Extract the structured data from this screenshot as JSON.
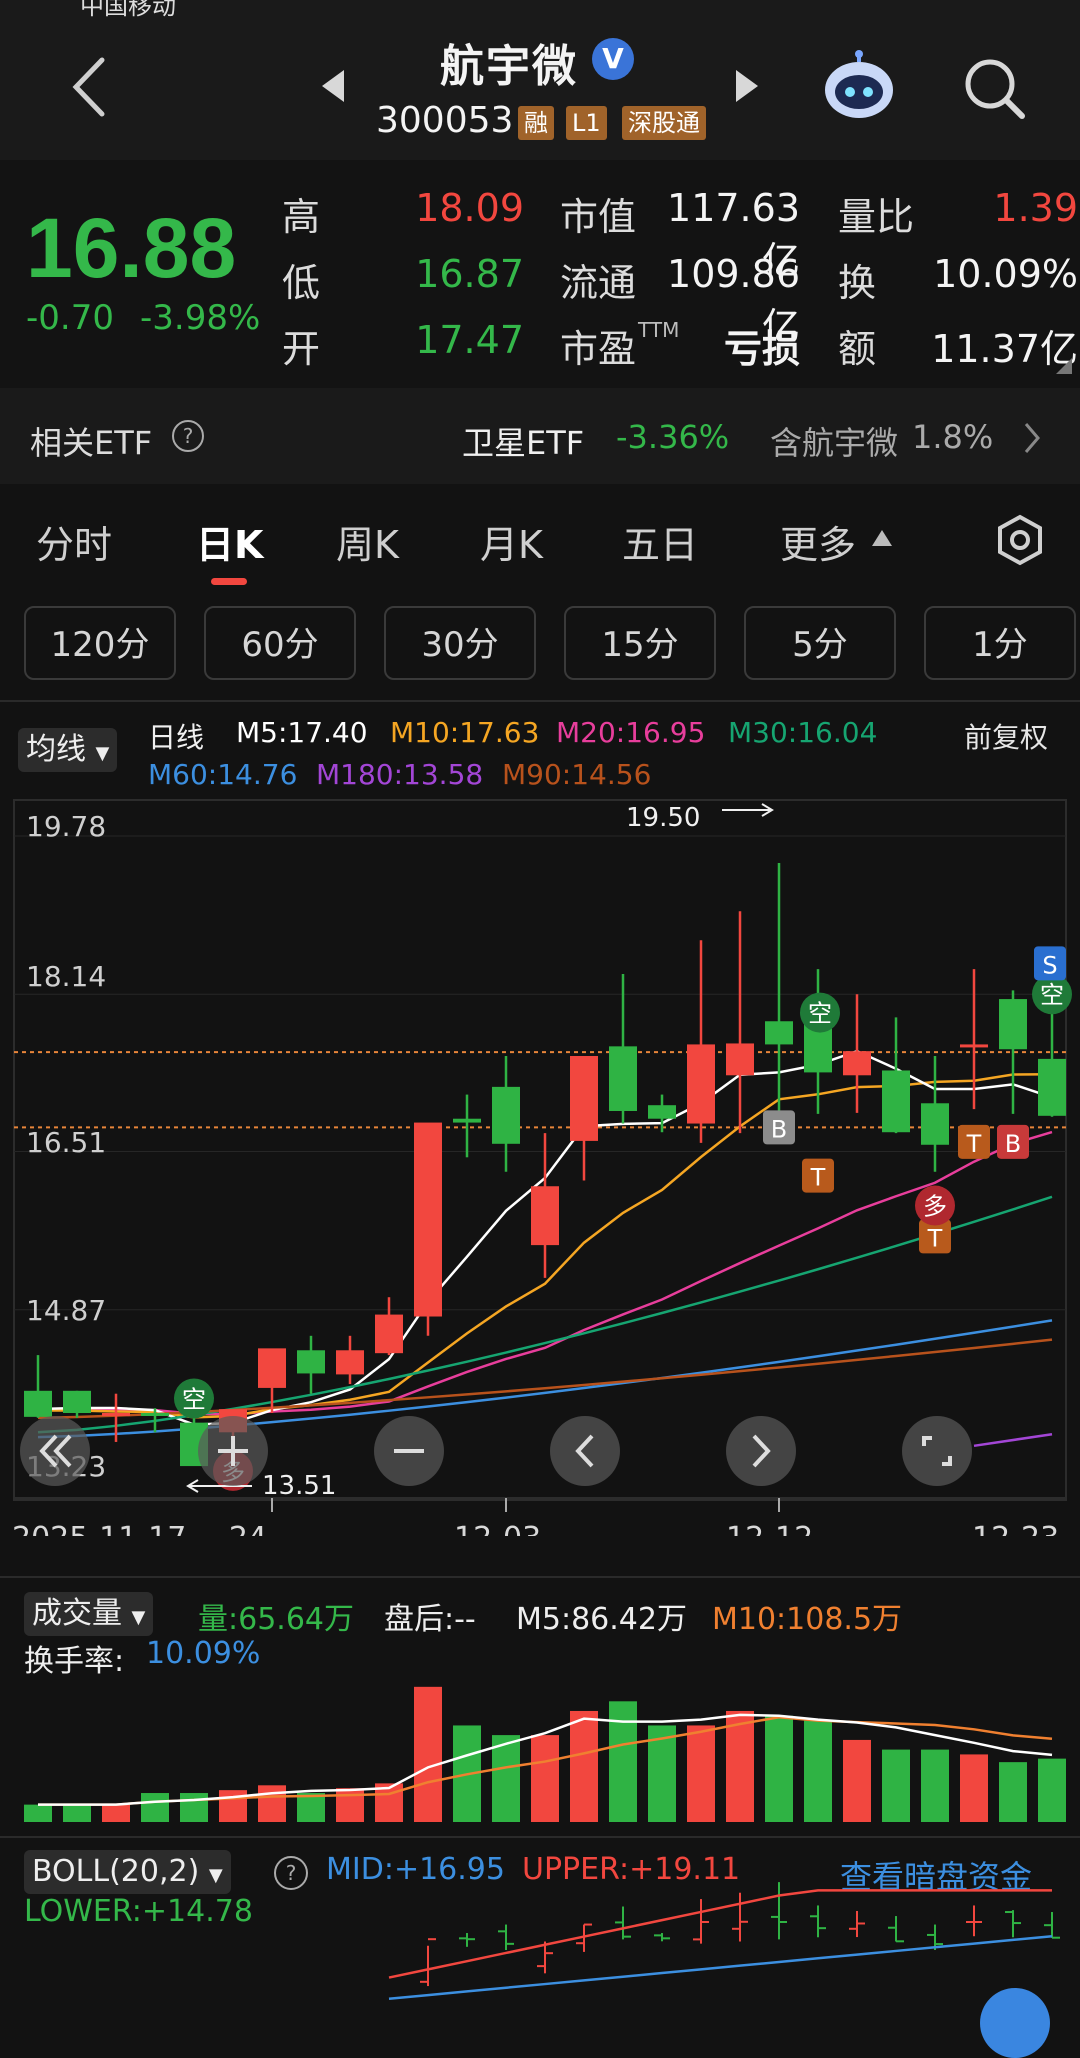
{
  "status_bar": {
    "carrier": "中国移动"
  },
  "header": {
    "title": "航宇微",
    "verified": "V",
    "code": "300053",
    "tags": [
      "融",
      "L1",
      "深股通"
    ]
  },
  "quote": {
    "price": "16.88",
    "change": "-0.70",
    "change_pct": "-3.98%",
    "high_label": "高",
    "high": "18.09",
    "low_label": "低",
    "low": "16.87",
    "open_label": "开",
    "open": "17.47",
    "mcap_label": "市值",
    "mcap": "117.63亿",
    "float_label": "流通",
    "float": "109.86亿",
    "pe_label": "市盈",
    "pe_sup": "TTM",
    "pe": "亏损",
    "vr_label": "量比",
    "vr": "1.39",
    "turnover_label": "换",
    "turnover": "10.09%",
    "amount_label": "额",
    "amount": "11.37亿"
  },
  "etf": {
    "label": "相关ETF",
    "help": "?",
    "name": "卫星ETF",
    "pct": "-3.36%",
    "contains": "含航宇微",
    "weight": "1.8%"
  },
  "tabs": [
    "分时",
    "日K",
    "周K",
    "月K",
    "五日",
    "更多"
  ],
  "periods": [
    "120分",
    "60分",
    "30分",
    "15分",
    "5分",
    "1分"
  ],
  "kline": {
    "selector": "均线",
    "interval": "日线",
    "adjust": "前复权",
    "ma": [
      {
        "label": "M5:17.40",
        "color": "#ffffff"
      },
      {
        "label": "M10:17.63",
        "color": "#f5a623"
      },
      {
        "label": "M20:16.95",
        "color": "#e83e9c"
      },
      {
        "label": "M30:16.04",
        "color": "#16a571"
      },
      {
        "label": "M60:14.76",
        "color": "#3c8fe0"
      },
      {
        "label": "M180:13.58",
        "color": "#a346d6"
      },
      {
        "label": "M90:14.56",
        "color": "#b8521c"
      }
    ],
    "yticks": [
      "19.78",
      "18.14",
      "16.51",
      "14.87",
      "13.23"
    ],
    "max_label": "19.50",
    "min_label": "13.51",
    "dates": [
      "2025-11-17",
      "-24",
      "12-03",
      "12-12",
      "12-23"
    ],
    "signals": {
      "kong": "空",
      "duo": "多",
      "B": "B",
      "T": "T",
      "S": "S"
    }
  },
  "volume": {
    "selector": "成交量",
    "vol": "量:65.64万",
    "after": "盘后:--",
    "m5": "M5:86.42万",
    "m10": "M10:108.5万",
    "turnover_label": "换手率:",
    "turnover": "10.09%"
  },
  "boll": {
    "selector": "BOLL(20,2)",
    "help": "?",
    "mid": "MID:+16.95",
    "upper": "UPPER:+19.11",
    "lower": "LOWER:+14.78",
    "link": "查看暗盘资金"
  },
  "chart_data": {
    "type": "candlestick",
    "dates": [
      "2025-11-17",
      "11-18",
      "11-19",
      "11-20",
      "11-21",
      "11-24",
      "11-25",
      "11-26",
      "11-27",
      "11-28",
      "12-01",
      "12-02",
      "12-03",
      "12-04",
      "12-05",
      "12-08",
      "12-09",
      "12-10",
      "12-11",
      "12-12",
      "12-15",
      "12-16",
      "12-17",
      "12-18",
      "12-19",
      "12-22",
      "12-23"
    ],
    "ohlc": [
      [
        14.03,
        14.4,
        13.75,
        13.76
      ],
      [
        14.03,
        14.03,
        13.75,
        13.8
      ],
      [
        13.8,
        14.0,
        13.5,
        13.8
      ],
      [
        13.8,
        13.85,
        13.6,
        13.79
      ],
      [
        13.7,
        13.85,
        13.4,
        13.25
      ],
      [
        13.6,
        13.75,
        13.51,
        13.84
      ],
      [
        14.06,
        14.25,
        13.8,
        14.47
      ],
      [
        14.45,
        14.6,
        14.0,
        14.21
      ],
      [
        14.2,
        14.6,
        14.1,
        14.45
      ],
      [
        14.42,
        15.0,
        14.4,
        14.82
      ],
      [
        14.8,
        16.5,
        14.6,
        16.81
      ],
      [
        16.85,
        17.1,
        16.45,
        16.81
      ],
      [
        17.18,
        17.5,
        16.3,
        16.59
      ],
      [
        15.54,
        16.7,
        15.2,
        16.15
      ],
      [
        16.62,
        17.5,
        16.21,
        17.5
      ],
      [
        17.6,
        18.35,
        16.8,
        16.93
      ],
      [
        16.99,
        17.1,
        16.71,
        16.85
      ],
      [
        16.8,
        18.7,
        16.6,
        17.62
      ],
      [
        17.3,
        19.0,
        16.7,
        17.63
      ],
      [
        17.86,
        19.5,
        16.8,
        17.62
      ],
      [
        17.89,
        18.4,
        16.9,
        17.33
      ],
      [
        17.3,
        18.14,
        16.91,
        17.55
      ],
      [
        17.35,
        17.9,
        16.7,
        16.71
      ],
      [
        17.01,
        17.5,
        16.3,
        16.58
      ],
      [
        17.62,
        18.4,
        16.95,
        17.62
      ],
      [
        18.09,
        18.18,
        16.9,
        17.57
      ],
      [
        17.47,
        18.09,
        16.87,
        16.88
      ]
    ],
    "ma5_last": 17.4,
    "ma10_last": 17.63,
    "ma20_last": 16.95,
    "ma30_last": 16.04,
    "ma60_last": 14.76,
    "ma180_last": 13.58,
    "ma90_last": 14.56,
    "ylim": [
      13.23,
      19.78
    ],
    "volume_wan": [
      18,
      18,
      18,
      30,
      30,
      33,
      38,
      30,
      35,
      40,
      140,
      100,
      90,
      90,
      115,
      125,
      100,
      100,
      115,
      110,
      105,
      85,
      75,
      75,
      70,
      62,
      65.64
    ],
    "boll": {
      "mid": 16.95,
      "upper": 19.11,
      "lower": 14.78
    }
  }
}
